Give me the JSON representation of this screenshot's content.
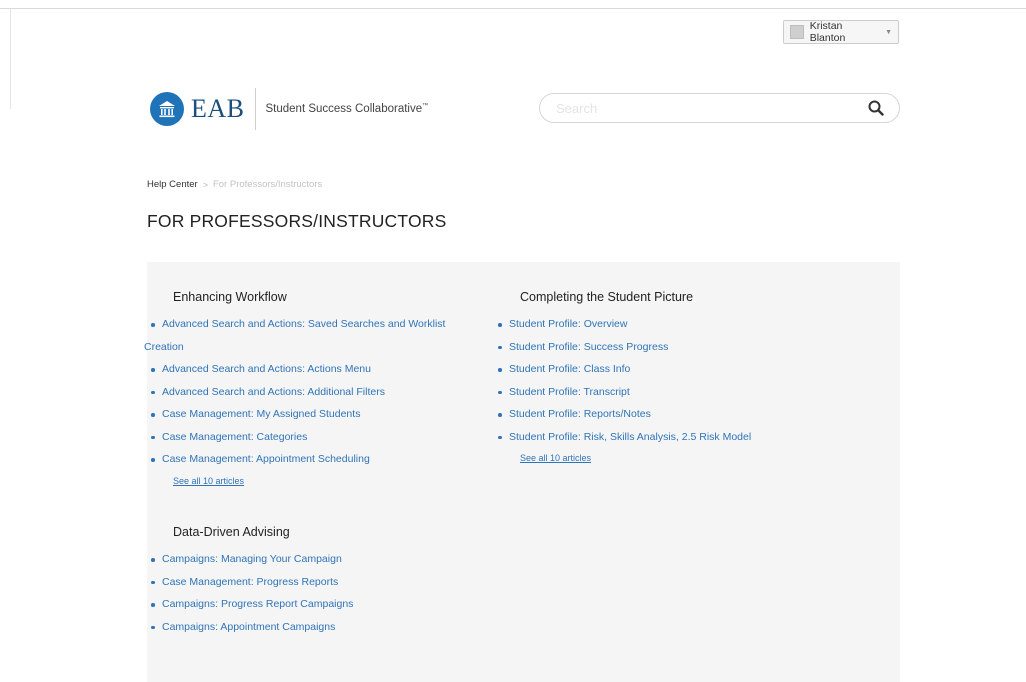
{
  "header": {
    "user_name": "Kristan Blanton",
    "logo_wordmark": "EAB",
    "logo_tagline": "Student Success Collaborative",
    "logo_trademark": "™",
    "search_placeholder": "Search"
  },
  "breadcrumb": {
    "home": "Help Center",
    "separator": ">",
    "current": "For Professors/Instructors"
  },
  "page_title": "FOR PROFESSORS/INSTRUCTORS",
  "sections": [
    {
      "title": "Enhancing Workflow",
      "articles": [
        "Advanced Search and Actions: Saved Searches and Worklist",
        "Creation",
        "Advanced Search and Actions: Actions Menu",
        "Advanced Search and Actions: Additional Filters",
        "Case Management: My Assigned Students",
        "Case Management: Categories",
        "Case Management: Appointment Scheduling"
      ],
      "see_all": "See all 10 articles"
    },
    {
      "title": "Completing the Student Picture",
      "articles": [
        "Student Profile: Overview",
        "Student Profile: Success Progress",
        "Student Profile: Class Info",
        "Student Profile: Transcript",
        "Student Profile: Reports/Notes",
        "Student Profile: Risk, Skills Analysis, 2.5 Risk Model"
      ],
      "see_all": "See all 10 articles"
    },
    {
      "title": "Data-Driven Advising",
      "articles": [
        "Campaigns: Managing Your Campaign",
        "Case Management: Progress Reports",
        "Campaigns: Progress Report Campaigns",
        "Campaigns: Appointment Campaigns"
      ]
    }
  ],
  "colors": {
    "link": "#2f74b8",
    "logo_seal": "#1f74b9",
    "panel_bg": "#f5f5f5"
  },
  "icons": [
    "user-avatar-icon",
    "caret-down-icon",
    "eab-seal-icon",
    "search-icon"
  ]
}
